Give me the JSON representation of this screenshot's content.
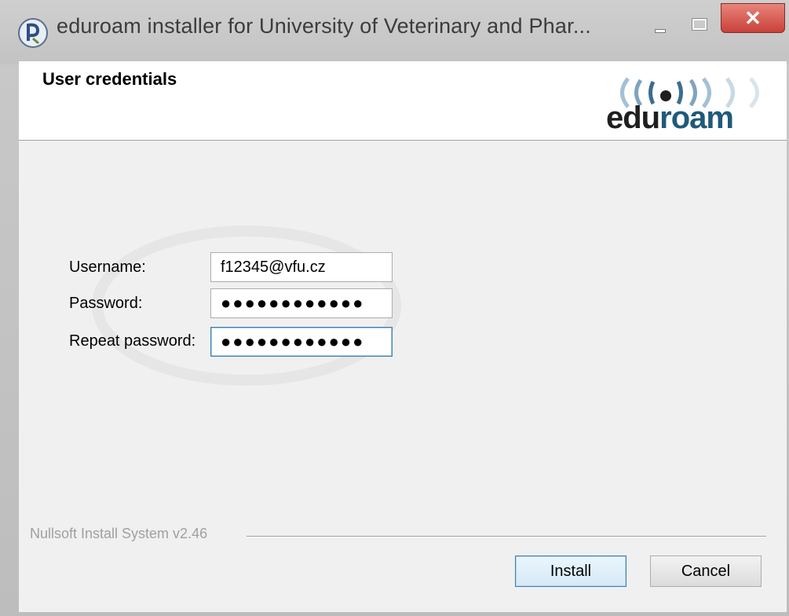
{
  "window": {
    "title": "eduroam installer for University of Veterinary and Phar...",
    "controls": {
      "close_glyph": "✕"
    }
  },
  "header": {
    "title": "User credentials",
    "logo": {
      "edu": "edu",
      "roam": "roam"
    }
  },
  "form": {
    "username_label": "Username:",
    "username_value": "f12345@vfu.cz",
    "password_label": "Password:",
    "password_value": "●●●●●●●●●●●●",
    "repeat_label": "Repeat password:",
    "repeat_value": "●●●●●●●●●●●●"
  },
  "footer": {
    "branding": "Nullsoft Install System v2.46",
    "install_label": "Install",
    "cancel_label": "Cancel"
  },
  "colors": {
    "close_red": "#c9413a",
    "focus_blue": "#3c7fb1",
    "logo_blue": "#1f5a7a"
  },
  "icons": [
    "app-icon",
    "minimize-icon",
    "maximize-icon",
    "close-icon",
    "eduroam-logo"
  ]
}
